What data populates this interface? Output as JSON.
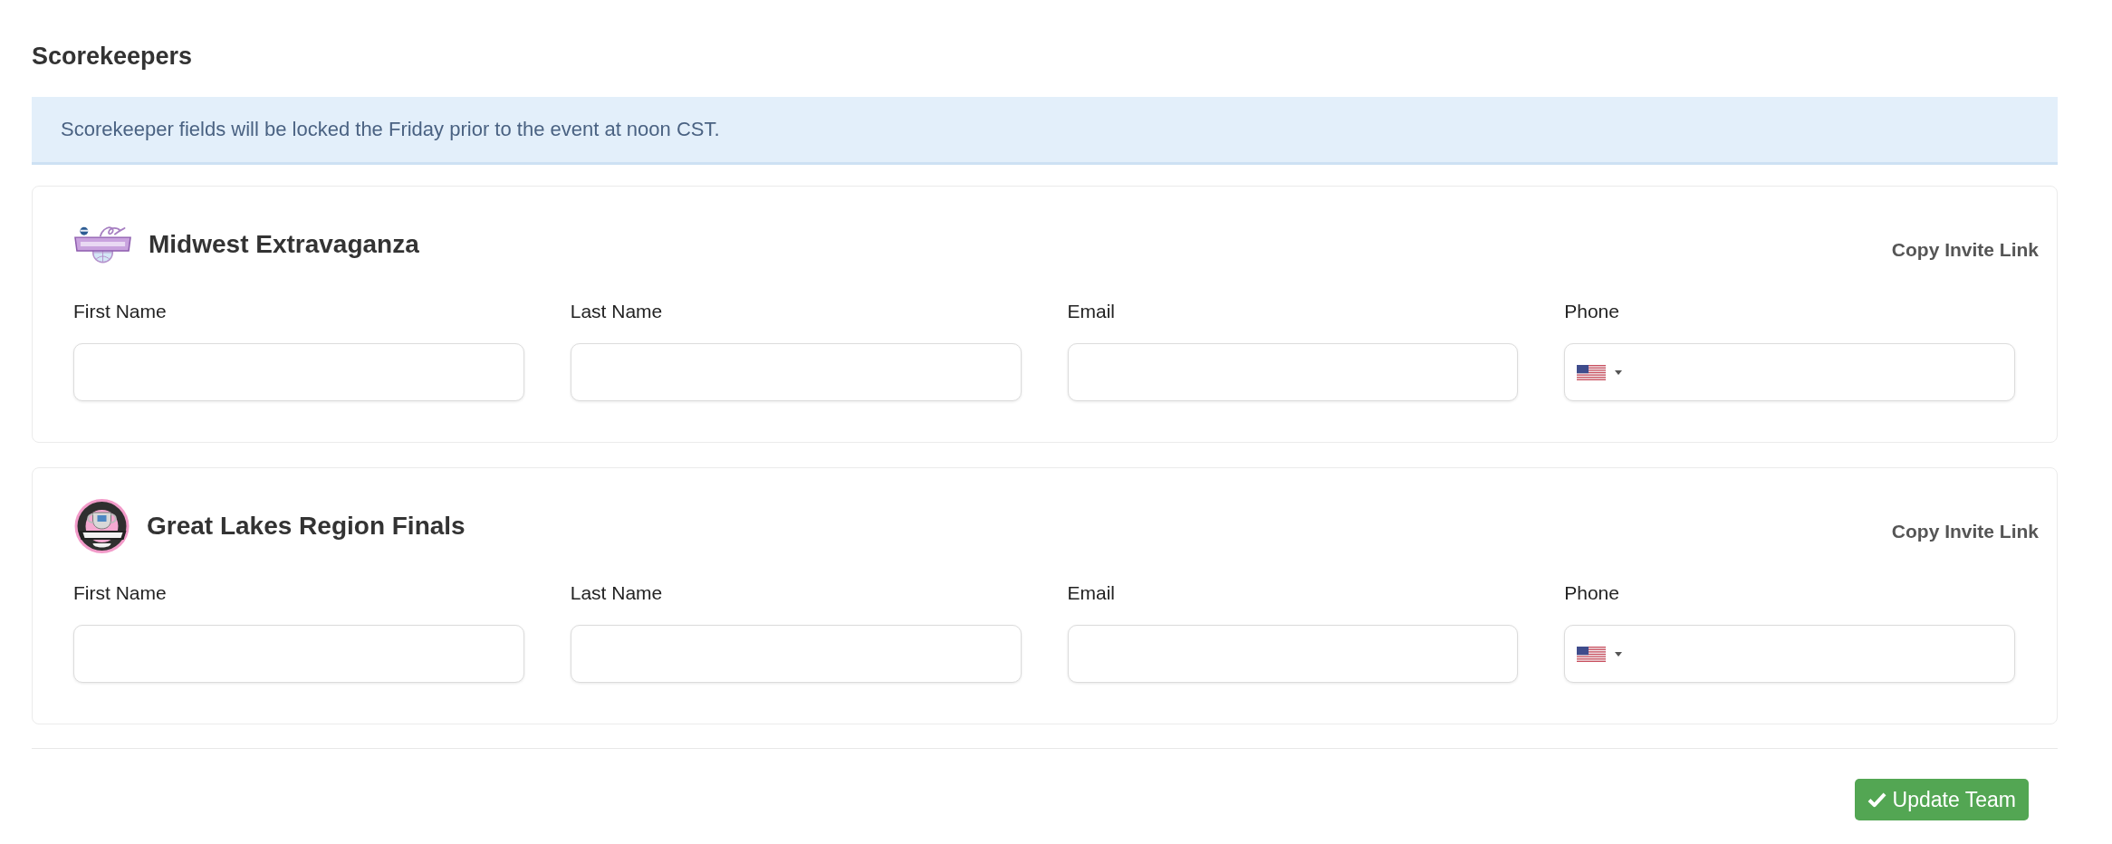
{
  "section": {
    "title": "Scorekeepers"
  },
  "alert": {
    "text": "Scorekeeper fields will be locked the Friday prior to the event at noon CST."
  },
  "events": [
    {
      "name": "Midwest Extravaganza",
      "kind": "banner",
      "action": "Copy Invite Link",
      "fields": [
        {
          "label": "First Name",
          "kind": "text"
        },
        {
          "label": "Last Name",
          "kind": "text"
        },
        {
          "label": "Email",
          "kind": "text"
        },
        {
          "label": "Phone",
          "kind": "phone"
        }
      ]
    },
    {
      "name": "Great Lakes Region Finals",
      "kind": "badge",
      "action": "Copy Invite Link",
      "fields": [
        {
          "label": "First Name",
          "kind": "text"
        },
        {
          "label": "Last Name",
          "kind": "text"
        },
        {
          "label": "Email",
          "kind": "text"
        },
        {
          "label": "Phone",
          "kind": "phone"
        }
      ]
    }
  ],
  "footer": {
    "button": "Update Team"
  }
}
